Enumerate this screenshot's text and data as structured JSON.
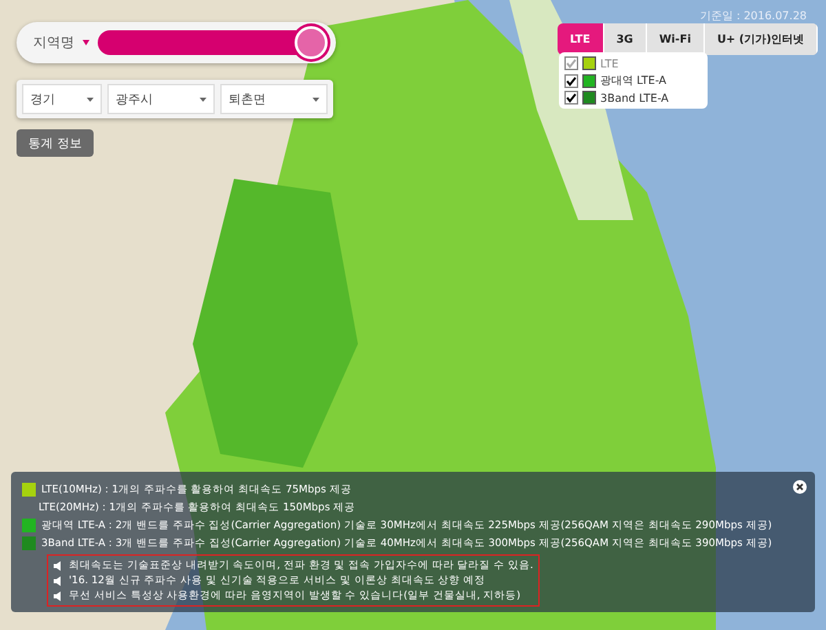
{
  "search": {
    "label": "지역명"
  },
  "selects": [
    {
      "value": "경기"
    },
    {
      "value": "광주시"
    },
    {
      "value": "퇴촌면"
    }
  ],
  "stats_button": "통계 정보",
  "date": "기준일 : 2016.07.28",
  "tabs": [
    {
      "label": "LTE",
      "selected": true
    },
    {
      "label": "3G",
      "selected": false
    },
    {
      "label": "Wi-Fi",
      "selected": false
    },
    {
      "label": "U+ (기가)인터넷",
      "selected": false
    }
  ],
  "layers": [
    {
      "label": "LTE",
      "checked": true,
      "disabled": true,
      "color": "#a6d20e"
    },
    {
      "label": "광대역 LTE-A",
      "checked": true,
      "disabled": false,
      "color": "#22b422"
    },
    {
      "label": "3Band LTE-A",
      "checked": true,
      "disabled": false,
      "color": "#1f8a1f"
    }
  ],
  "legend": {
    "items": [
      {
        "text": "LTE(10MHz) : 1개의 주파수를 활용하여 최대속도 75Mbps 제공",
        "color": "#a6d20e"
      },
      {
        "text": "LTE(20MHz) : 1개의 주파수를 활용하여 최대속도 150Mbps 제공"
      },
      {
        "text": "광대역 LTE-A : 2개 밴드를 주파수 집성(Carrier Aggregation) 기술로 30MHz에서 최대속도 225Mbps 제공(256QAM 지역은 최대속도 290Mbps 제공)",
        "color": "#22b422"
      },
      {
        "text": "3Band LTE-A : 3개 밴드를 주파수 집성(Carrier Aggregation) 기술로 40MHz에서 최대속도 300Mbps 제공(256QAM 지역은 최대속도 390Mbps 제공)",
        "color": "#1f8a1f"
      }
    ],
    "notes": [
      "최대속도는 기술표준상 내려받기 속도이며, 전파 환경 및 접속 가입자수에 따라 달라질 수 있음.",
      "'16. 12월 신규 주파수 사용 및 신기술 적용으로 서비스 및 이론상 최대속도 상향 예정",
      "무선 서비스 특성상 사용환경에 따라 음영지역이 발생할 수 있습니다(일부 건물실내, 지하등)"
    ]
  }
}
